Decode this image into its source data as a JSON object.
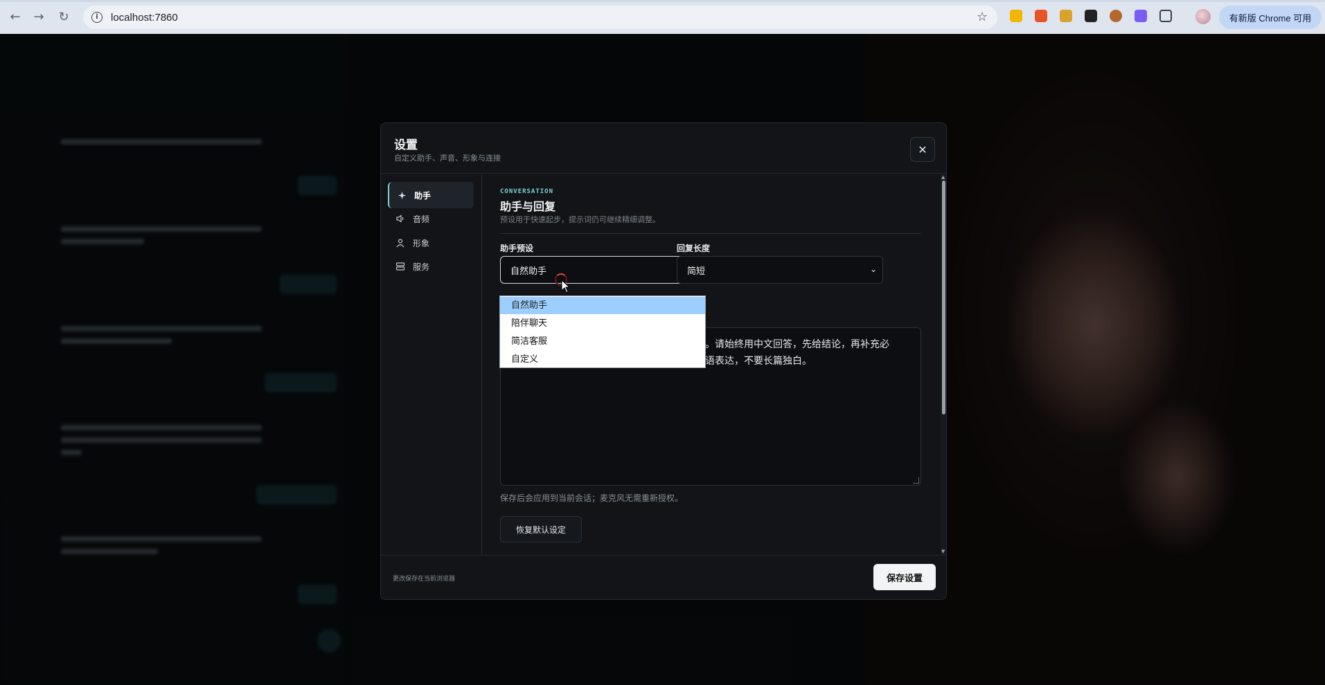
{
  "browser": {
    "url": "localhost:7860",
    "update_label": "有新版 Chrome 可用"
  },
  "modal": {
    "title": "设置",
    "subtitle": "自定义助手、声音、形象与连接",
    "nav": [
      {
        "label": "助手",
        "icon": "sparkle-icon",
        "active": true
      },
      {
        "label": "音频",
        "icon": "speaker-icon",
        "active": false
      },
      {
        "label": "形象",
        "icon": "person-icon",
        "active": false
      },
      {
        "label": "服务",
        "icon": "server-icon",
        "active": false
      }
    ],
    "section": {
      "eyebrow": "CONVERSATION",
      "title": "助手与回复",
      "description": "预设用于快速起步，提示词仍可继续精细调整。"
    },
    "preset": {
      "label": "助手预设",
      "value": "自然助手",
      "options": [
        "自然助手",
        "陪伴聊天",
        "简洁客服",
        "自定义"
      ]
    },
    "reply_length": {
      "label": "回复长度",
      "value": "简短"
    },
    "prompt_text": {
      "line1": "。请始终用中文回答，先给结论，再补充必",
      "line2": "语表达，不要长篇独白。"
    },
    "hint": "保存后会应用到当前会话；麦克风无需重新授权。",
    "reset_label": "恢复默认设定",
    "footer_note": "更改保存在当前浏览器",
    "save_label": "保存设置"
  }
}
